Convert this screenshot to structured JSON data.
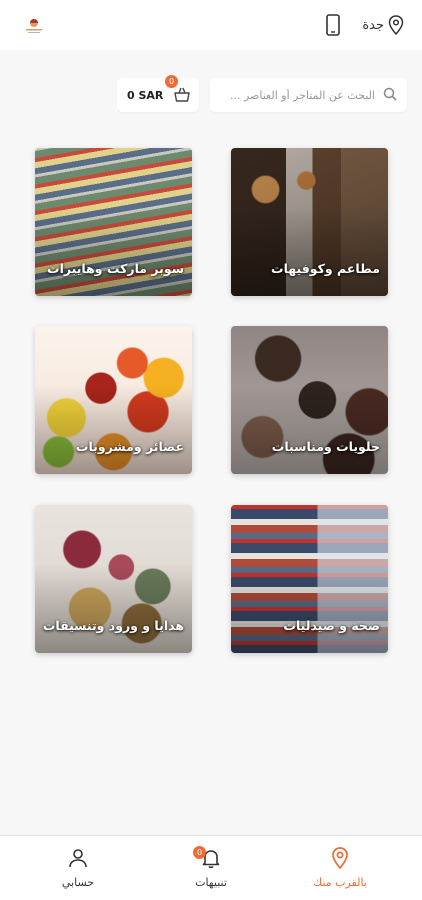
{
  "header": {
    "city": "جدة",
    "icons": {
      "location": "location-pin-icon",
      "phone": "phone-icon",
      "logo": "app-logo"
    }
  },
  "search": {
    "placeholder": "البحث عن المتاجر أو العناصر ..."
  },
  "cart": {
    "amount": "0 SAR",
    "badge_count": "0"
  },
  "categories": [
    {
      "label": "مطاعم وكوفيهات"
    },
    {
      "label": "سوبر ماركت وهايبرات"
    },
    {
      "label": "حلويات ومناسبات"
    },
    {
      "label": "عصائر ومشروبات"
    },
    {
      "label": "صحة و صيدليات"
    },
    {
      "label": "هدايا و ورود وتنسيقات"
    }
  ],
  "bottom_nav": {
    "items": [
      {
        "label": "بالقرب منك",
        "icon": "location-pin-icon",
        "active": true
      },
      {
        "label": "تنبيهات",
        "icon": "bell-icon",
        "badge": "0"
      },
      {
        "label": "حسابي",
        "icon": "user-icon"
      }
    ]
  },
  "colors": {
    "accent": "#ef6a35",
    "background": "#f7f7f7"
  }
}
